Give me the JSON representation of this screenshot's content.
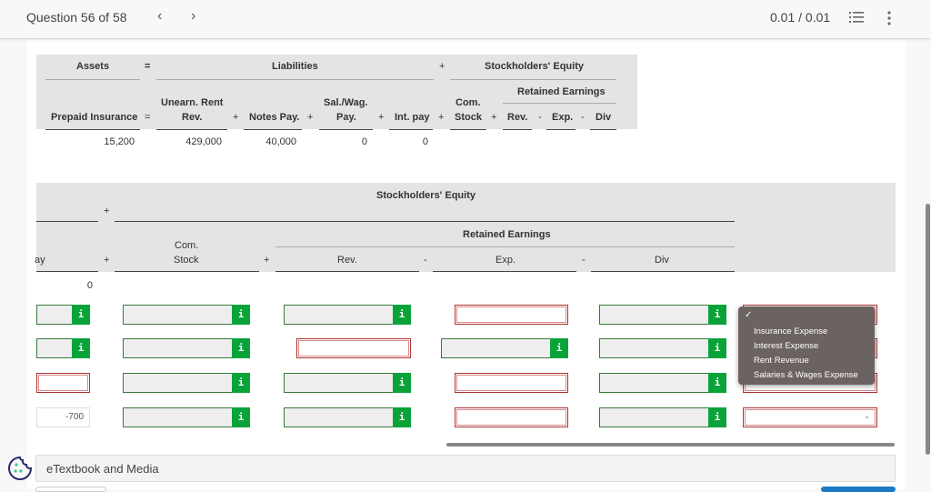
{
  "header": {
    "question_label": "Question 56 of 58",
    "prev_glyph": "‹",
    "next_glyph": "›",
    "score": "0.01 / 0.01"
  },
  "table1": {
    "groups": {
      "assets": "Assets",
      "eq": "=",
      "liabilities": "Liabilities",
      "plus": "+",
      "equity": "Stockholders' Equity",
      "retained": "Retained Earnings"
    },
    "columns": {
      "prepaid": "Prepaid Insurance",
      "eq": "=",
      "unearn_1": "Unearn. Rent",
      "unearn_2": "Rev.",
      "plus1": "+",
      "notes": "Notes Pay.",
      "plus2": "+",
      "sal_1": "Sal./Wag.",
      "sal_2": "Pay.",
      "plus3": "+",
      "intpay": "Int. pay",
      "plus4": "+",
      "com_1": "Com.",
      "com_2": "Stock",
      "plus5": "+",
      "rev": "Rev.",
      "minus1": "-",
      "exp": "Exp.",
      "minus2": "-",
      "div": "Div"
    },
    "values": {
      "prepaid": "15,200",
      "unearn": "429,000",
      "notes": "40,000",
      "sal": "0",
      "intpay": "0"
    }
  },
  "table2": {
    "equity": "Stockholders' Equity",
    "plus": "+",
    "retained": "Retained Earnings",
    "columns": {
      "partial_left": "ay",
      "plus1": "+",
      "com_1": "Com.",
      "com_2": "Stock",
      "plus2": "+",
      "rev": "Rev.",
      "minus1": "-",
      "exp": "Exp.",
      "minus2": "-",
      "div": "Div"
    },
    "opening_value": "0",
    "rows": [
      {
        "intpay": "correct",
        "stock": "correct",
        "rev": "correct",
        "exp": "incorrect",
        "div": "correct",
        "account": "incorrect"
      },
      {
        "intpay": "correct",
        "stock": "correct",
        "rev": "incorrect",
        "exp": "correct",
        "div": "correct",
        "account": "incorrect"
      },
      {
        "intpay": "incorrect",
        "stock": "correct",
        "rev": "correct",
        "exp": "incorrect",
        "div": "correct",
        "account": "incorrect"
      },
      {
        "intpay": "-700",
        "stock": "correct",
        "rev": "correct",
        "exp": "incorrect",
        "div": "correct",
        "account": "incorrect"
      }
    ],
    "info_glyph": "i",
    "colors": {
      "correct": "#0aa33a",
      "incorrect": "#aa3333"
    }
  },
  "dropdown": {
    "check": "✓",
    "options": [
      "Insurance Expense",
      "Interest Expense",
      "Rent Revenue",
      "Salaries & Wages Expense"
    ]
  },
  "footer": {
    "etextbook": "eTextbook and Media"
  }
}
